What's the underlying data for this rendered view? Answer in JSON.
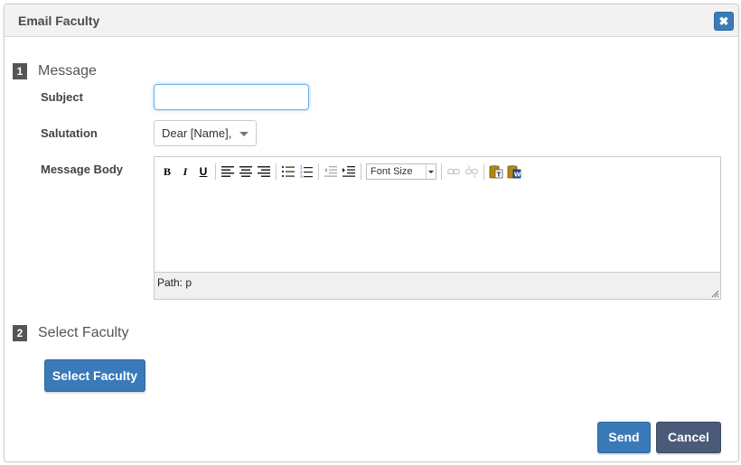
{
  "dialog": {
    "title": "Email Faculty",
    "close_icon": "close-icon",
    "close_symbol": "✖"
  },
  "sections": [
    {
      "number": "1",
      "title": "Message"
    },
    {
      "number": "2",
      "title": "Select Faculty"
    }
  ],
  "form": {
    "subject_label": "Subject",
    "subject_value": "",
    "salutation_label": "Salutation",
    "salutation_value": "Dear [Name],",
    "body_label": "Message Body"
  },
  "editor": {
    "toolbar": {
      "bold": "B",
      "italic": "I",
      "underline": "U",
      "font_size": "Font Size"
    },
    "path_text": "Path: p"
  },
  "buttons": {
    "select_faculty": "Select Faculty",
    "send": "Send",
    "cancel": "Cancel"
  },
  "colors": {
    "primary": "#3a7ab8",
    "dark": "#4a5a78"
  }
}
